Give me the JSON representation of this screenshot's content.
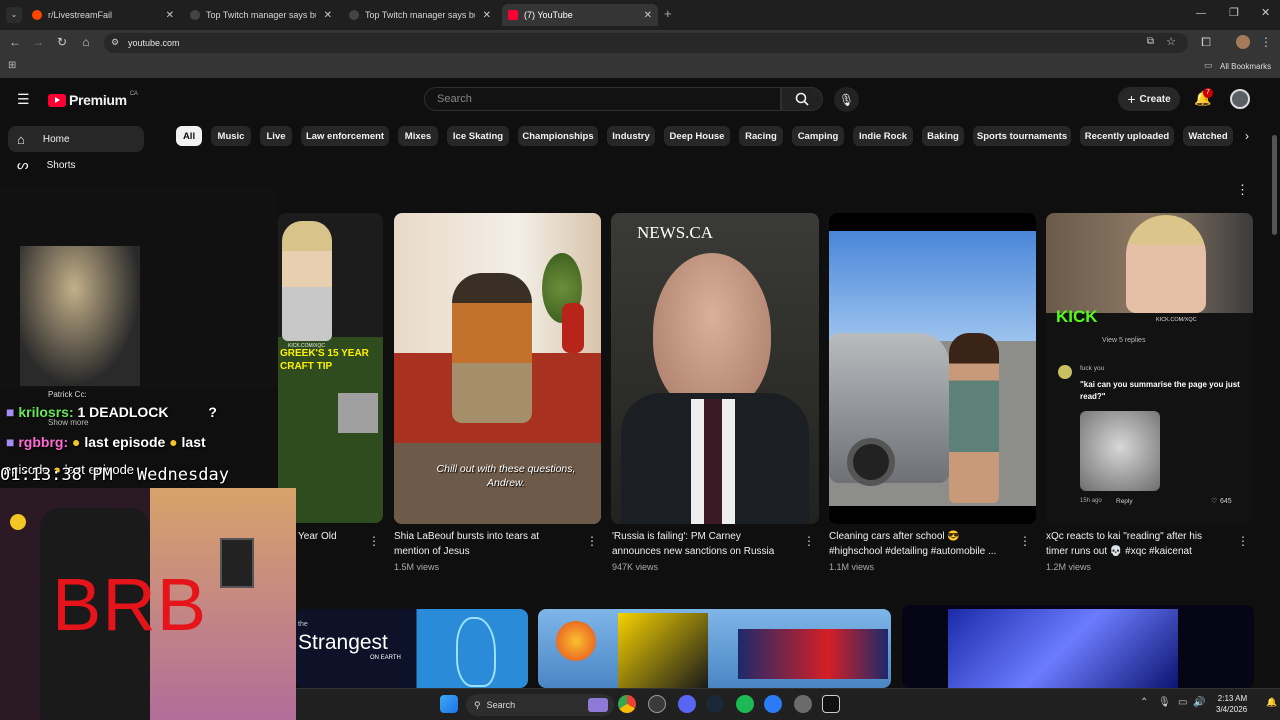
{
  "browser": {
    "tabs": [
      {
        "title": "r/LivestreamFail",
        "active": false
      },
      {
        "title": "Top Twitch manager says buyin",
        "active": false
      },
      {
        "title": "Top Twitch manager says buyin",
        "active": false
      },
      {
        "title": "(7) YouTube",
        "active": true
      }
    ],
    "url": "youtube.com",
    "bookmarks_label": "All Bookmarks"
  },
  "youtube": {
    "logo_text": "Premium",
    "region": "CA",
    "search_placeholder": "Search",
    "create_label": "Create",
    "notification_count": "7",
    "sidebar": [
      {
        "label": "Home",
        "icon": "home-icon"
      },
      {
        "label": "Shorts",
        "icon": "shorts-icon"
      }
    ],
    "chips": [
      "All",
      "Music",
      "Live",
      "Law enforcement",
      "Mixes",
      "Ice Skating",
      "Championships",
      "Industry",
      "Deep House",
      "Racing",
      "Camping",
      "Indie Rock",
      "Baking",
      "Sports tournaments",
      "Recently uploaded",
      "Watched"
    ],
    "shorts": [
      {
        "title_line1": "Year Old",
        "title_line2": "",
        "views": "",
        "thumb_text": "GREEK'S 15 YEAR CRAFT TIP",
        "watermark": "KICK.COM/XQC"
      },
      {
        "title_line1": "Shia LaBeouf bursts into tears at",
        "title_line2": "mention of Jesus",
        "views": "1.5M views",
        "caption": "Chill out with these questions, Andrew."
      },
      {
        "title_line1": "'Russia is failing': PM Carney",
        "title_line2": "announces new sanctions on Russia",
        "views": "947K views",
        "thumb_text": "NEWS.CA"
      },
      {
        "title_line1": "Cleaning cars after school 😎",
        "title_line2": "#highschool #detailing #automobile ...",
        "views": "1.1M views"
      },
      {
        "title_line1": "xQc reacts to kai \"reading\" after his",
        "title_line2": "timer runs out 💀 #xqc #kaicenat",
        "views": "1.2M views",
        "thumb_kick": "KICK",
        "thumb_url": "KICK.COM/XQC",
        "thumb_replies": "View 5 replies",
        "thumb_user": "fuck you",
        "thumb_comment": "\"kai can you summarise the page you just read?\"",
        "thumb_time": "15h ago",
        "thumb_reply": "Reply",
        "thumb_likes": "645"
      }
    ],
    "row2": {
      "strangest_title": "Strangest",
      "strangest_sub": "ON EARTH",
      "strangest_prefix": "the"
    }
  },
  "stream": {
    "chat": [
      {
        "user": "Patrick Cc:",
        "msg": ""
      },
      {
        "user": "krilosrs:",
        "msg": "1 DEADLOCK",
        "suffix": "?"
      },
      {
        "user": "rgbbrg:",
        "msg": "last episode",
        "suffix": "last"
      },
      {
        "user": "episode",
        "msg": "last episode",
        "suffix": ""
      }
    ],
    "show_more": "Show more",
    "timestamp": "01:13:38 PM",
    "day": "Wednesday",
    "brb": "BRB"
  },
  "taskbar": {
    "search_label": "Search",
    "time": "2:13 AM",
    "date": "3/4/2026"
  }
}
